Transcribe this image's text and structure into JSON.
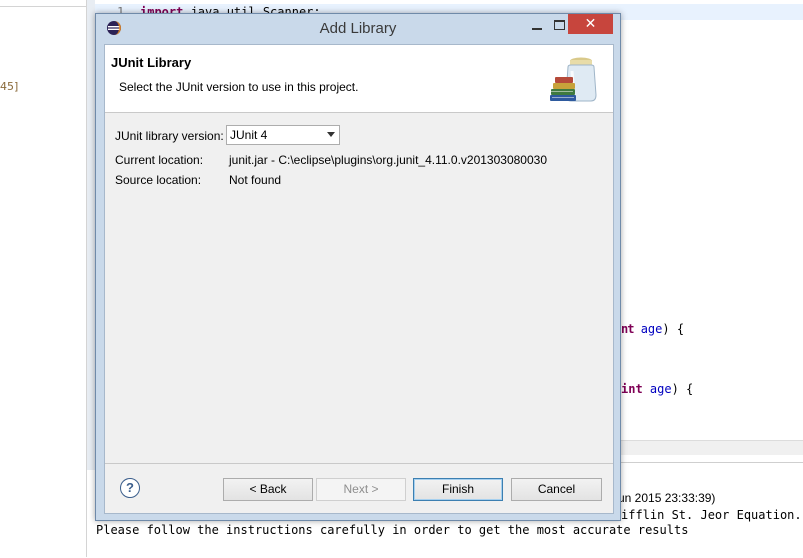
{
  "background": {
    "left_fragment": "45]",
    "editor": {
      "line_number": "1",
      "line1_keyword": "import",
      "line1_rest": " java.util.Scanner;",
      "method1_kw": "int",
      "method1_param": "age",
      "method1_tail": ") {",
      "method2_kw": "int",
      "method2_param": "age",
      "method2_tail": ") {"
    },
    "console": {
      "header_fragment": "un 2015 23:33:39)",
      "line1_fragment": "ifflin St. Jeor Equation.",
      "line2": "Please follow the instructions carefully in order to get the most accurate results"
    }
  },
  "dialog": {
    "title": "Add Library",
    "close_glyph": "✕",
    "banner": {
      "title": "JUnit Library",
      "description": "Select the JUnit version to use in this project.",
      "icon": "library-jar-icon"
    },
    "fields": {
      "version_label": "JUnit library version:",
      "version_value": "JUnit 4",
      "current_location_label": "Current location:",
      "current_location_value": "junit.jar - C:\\eclipse\\plugins\\org.junit_4.11.0.v201303080030",
      "source_location_label": "Source location:",
      "source_location_value": "Not found"
    },
    "buttons": {
      "help": "?",
      "back": "< Back",
      "next": "Next >",
      "finish": "Finish",
      "cancel": "Cancel"
    }
  }
}
